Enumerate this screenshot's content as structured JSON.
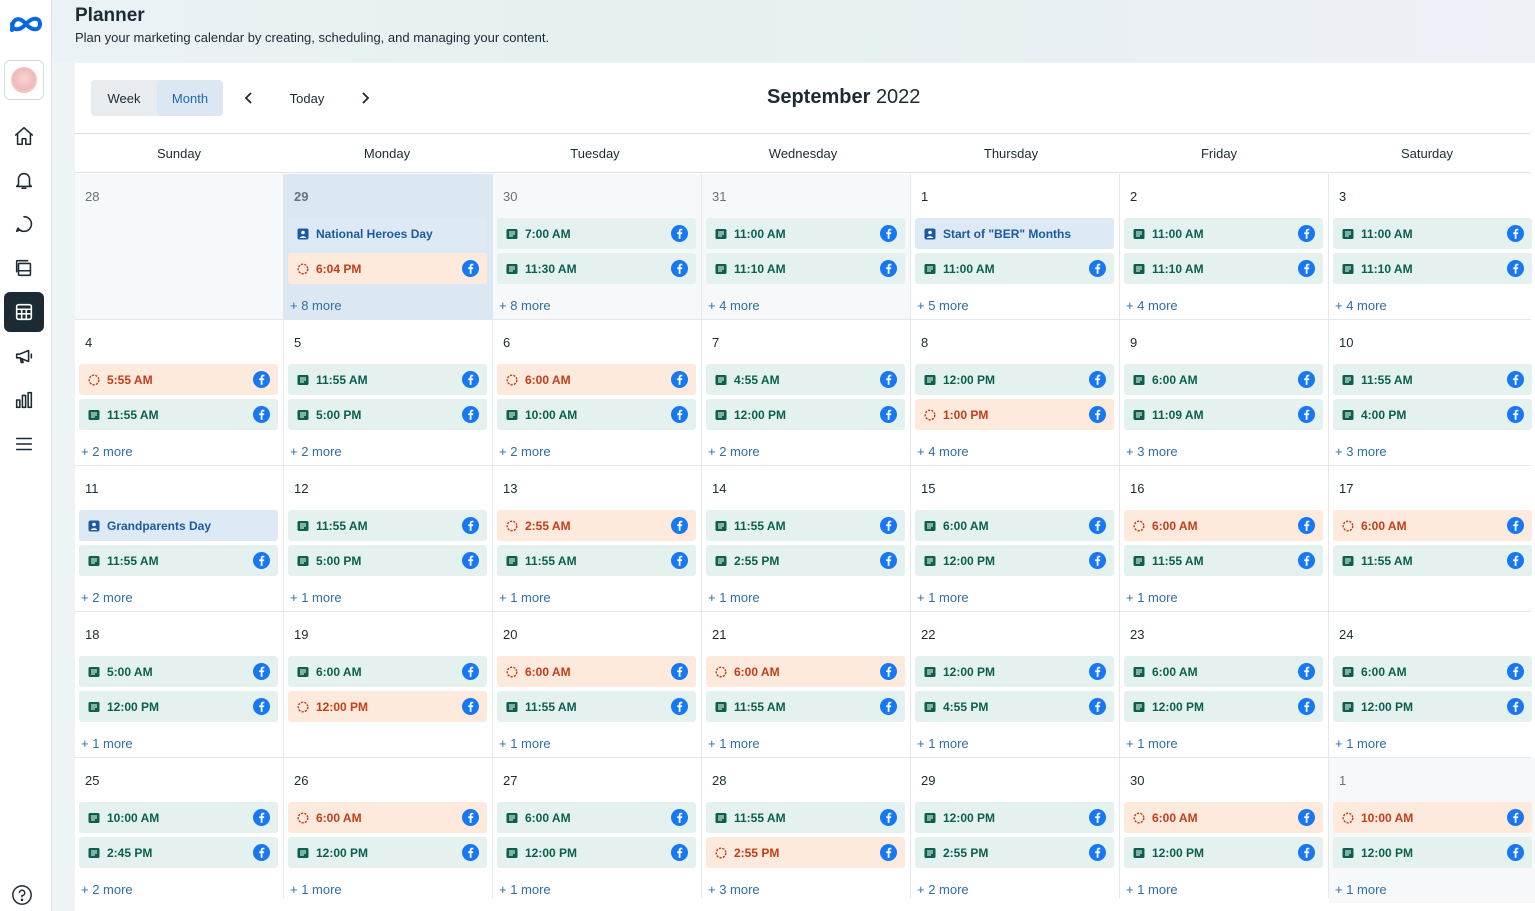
{
  "header": {
    "title": "Planner",
    "subtitle": "Plan your marketing calendar by creating, scheduling, and managing your content."
  },
  "toolbar": {
    "week_label": "Week",
    "month_label": "Month",
    "today_label": "Today",
    "month_name": "September",
    "year": "2022",
    "active_view": "Month"
  },
  "weekdays": [
    "Sunday",
    "Monday",
    "Tuesday",
    "Wednesday",
    "Thursday",
    "Friday",
    "Saturday"
  ],
  "colors": {
    "post_bg": "#e4f1ee",
    "post_text": "#0b5f4e",
    "draft_bg": "#fdeadc",
    "draft_text": "#c23e19",
    "holiday_bg": "#dde9f5",
    "holiday_text": "#1b5aa0",
    "facebook": "#1877f2",
    "more_link": "#2f6fa8"
  },
  "icons": [
    "meta-logo-icon",
    "home-icon",
    "bell-icon",
    "chat-icon",
    "content-icon",
    "calendar-icon",
    "megaphone-icon",
    "insights-icon",
    "menu-icon",
    "help-icon",
    "chevron-left-icon",
    "chevron-right-icon",
    "facebook-icon",
    "post-icon",
    "draft-icon",
    "holiday-icon"
  ],
  "days": [
    {
      "day": "28",
      "other": true,
      "events": [],
      "more": ""
    },
    {
      "day": "29",
      "other": true,
      "today": true,
      "events": [
        {
          "type": "holiday",
          "label": "National Heroes Day"
        },
        {
          "type": "draft",
          "label": "6:04 PM"
        }
      ],
      "more": "+ 8 more"
    },
    {
      "day": "30",
      "other": true,
      "events": [
        {
          "type": "post",
          "label": "7:00 AM"
        },
        {
          "type": "post",
          "label": "11:30 AM"
        }
      ],
      "more": "+ 8 more"
    },
    {
      "day": "31",
      "other": true,
      "events": [
        {
          "type": "post",
          "label": "11:00 AM"
        },
        {
          "type": "post",
          "label": "11:10 AM"
        }
      ],
      "more": "+ 4 more"
    },
    {
      "day": "1",
      "events": [
        {
          "type": "holiday",
          "label": "Start of \"BER\" Months"
        },
        {
          "type": "post",
          "label": "11:00 AM"
        }
      ],
      "more": "+ 5 more"
    },
    {
      "day": "2",
      "events": [
        {
          "type": "post",
          "label": "11:00 AM"
        },
        {
          "type": "post",
          "label": "11:10 AM"
        }
      ],
      "more": "+ 4 more"
    },
    {
      "day": "3",
      "events": [
        {
          "type": "post",
          "label": "11:00 AM"
        },
        {
          "type": "post",
          "label": "11:10 AM"
        }
      ],
      "more": "+ 4 more"
    },
    {
      "day": "4",
      "events": [
        {
          "type": "draft",
          "label": "5:55 AM"
        },
        {
          "type": "post",
          "label": "11:55 AM"
        }
      ],
      "more": "+ 2 more"
    },
    {
      "day": "5",
      "events": [
        {
          "type": "post",
          "label": "11:55 AM"
        },
        {
          "type": "post",
          "label": "5:00 PM"
        }
      ],
      "more": "+ 2 more"
    },
    {
      "day": "6",
      "events": [
        {
          "type": "draft",
          "label": "6:00 AM"
        },
        {
          "type": "post",
          "label": "10:00 AM"
        }
      ],
      "more": "+ 2 more"
    },
    {
      "day": "7",
      "events": [
        {
          "type": "post",
          "label": "4:55 AM"
        },
        {
          "type": "post",
          "label": "12:00 PM"
        }
      ],
      "more": "+ 2 more"
    },
    {
      "day": "8",
      "events": [
        {
          "type": "post",
          "label": "12:00 PM"
        },
        {
          "type": "draft",
          "label": "1:00 PM"
        }
      ],
      "more": "+ 4 more"
    },
    {
      "day": "9",
      "events": [
        {
          "type": "post",
          "label": "6:00 AM"
        },
        {
          "type": "post",
          "label": "11:09 AM"
        }
      ],
      "more": "+ 3 more"
    },
    {
      "day": "10",
      "events": [
        {
          "type": "post",
          "label": "11:55 AM"
        },
        {
          "type": "post",
          "label": "4:00 PM"
        }
      ],
      "more": "+ 3 more"
    },
    {
      "day": "11",
      "events": [
        {
          "type": "holiday",
          "label": "Grandparents Day"
        },
        {
          "type": "post",
          "label": "11:55 AM"
        }
      ],
      "more": "+ 2 more"
    },
    {
      "day": "12",
      "events": [
        {
          "type": "post",
          "label": "11:55 AM"
        },
        {
          "type": "post",
          "label": "5:00 PM"
        }
      ],
      "more": "+ 1 more"
    },
    {
      "day": "13",
      "events": [
        {
          "type": "draft",
          "label": "2:55 AM"
        },
        {
          "type": "post",
          "label": "11:55 AM"
        }
      ],
      "more": "+ 1 more"
    },
    {
      "day": "14",
      "events": [
        {
          "type": "post",
          "label": "11:55 AM"
        },
        {
          "type": "post",
          "label": "2:55 PM"
        }
      ],
      "more": "+ 1 more"
    },
    {
      "day": "15",
      "events": [
        {
          "type": "post",
          "label": "6:00 AM"
        },
        {
          "type": "post",
          "label": "12:00 PM"
        }
      ],
      "more": "+ 1 more"
    },
    {
      "day": "16",
      "events": [
        {
          "type": "draft",
          "label": "6:00 AM"
        },
        {
          "type": "post",
          "label": "11:55 AM"
        }
      ],
      "more": "+ 1 more"
    },
    {
      "day": "17",
      "events": [
        {
          "type": "draft",
          "label": "6:00 AM"
        },
        {
          "type": "post",
          "label": "11:55 AM"
        }
      ],
      "more": ""
    },
    {
      "day": "18",
      "events": [
        {
          "type": "post",
          "label": "5:00 AM"
        },
        {
          "type": "post",
          "label": "12:00 PM"
        }
      ],
      "more": "+ 1 more"
    },
    {
      "day": "19",
      "events": [
        {
          "type": "post",
          "label": "6:00 AM"
        },
        {
          "type": "draft",
          "label": "12:00 PM"
        }
      ],
      "more": ""
    },
    {
      "day": "20",
      "events": [
        {
          "type": "draft",
          "label": "6:00 AM"
        },
        {
          "type": "post",
          "label": "11:55 AM"
        }
      ],
      "more": "+ 1 more"
    },
    {
      "day": "21",
      "events": [
        {
          "type": "draft",
          "label": "6:00 AM"
        },
        {
          "type": "post",
          "label": "11:55 AM"
        }
      ],
      "more": "+ 1 more"
    },
    {
      "day": "22",
      "events": [
        {
          "type": "post",
          "label": "12:00 PM"
        },
        {
          "type": "post",
          "label": "4:55 PM"
        }
      ],
      "more": "+ 1 more"
    },
    {
      "day": "23",
      "events": [
        {
          "type": "post",
          "label": "6:00 AM"
        },
        {
          "type": "post",
          "label": "12:00 PM"
        }
      ],
      "more": "+ 1 more"
    },
    {
      "day": "24",
      "events": [
        {
          "type": "post",
          "label": "6:00 AM"
        },
        {
          "type": "post",
          "label": "12:00 PM"
        }
      ],
      "more": "+ 1 more"
    },
    {
      "day": "25",
      "events": [
        {
          "type": "post",
          "label": "10:00 AM"
        },
        {
          "type": "post",
          "label": "2:45 PM"
        }
      ],
      "more": "+ 2 more"
    },
    {
      "day": "26",
      "events": [
        {
          "type": "draft",
          "label": "6:00 AM"
        },
        {
          "type": "post",
          "label": "12:00 PM"
        }
      ],
      "more": "+ 1 more"
    },
    {
      "day": "27",
      "events": [
        {
          "type": "post",
          "label": "6:00 AM"
        },
        {
          "type": "post",
          "label": "12:00 PM"
        }
      ],
      "more": "+ 1 more"
    },
    {
      "day": "28",
      "events": [
        {
          "type": "post",
          "label": "11:55 AM"
        },
        {
          "type": "draft",
          "label": "2:55 PM"
        }
      ],
      "more": "+ 3 more"
    },
    {
      "day": "29",
      "events": [
        {
          "type": "post",
          "label": "12:00 PM"
        },
        {
          "type": "post",
          "label": "2:55 PM"
        }
      ],
      "more": "+ 2 more"
    },
    {
      "day": "30",
      "events": [
        {
          "type": "draft",
          "label": "6:00 AM"
        },
        {
          "type": "post",
          "label": "12:00 PM"
        }
      ],
      "more": "+ 1 more"
    },
    {
      "day": "1",
      "other": true,
      "events": [
        {
          "type": "draft",
          "label": "10:00 AM"
        },
        {
          "type": "post",
          "label": "12:00 PM"
        }
      ],
      "more": "+ 1 more"
    }
  ]
}
